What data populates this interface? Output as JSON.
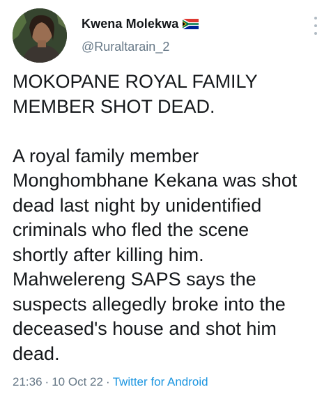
{
  "author": {
    "display_name": "Kwena Molekwa",
    "handle": "@Ruraltarain_2",
    "flag_icon": "south-africa-flag-icon",
    "avatar_icon": "profile-photo-avatar"
  },
  "menu": {
    "icon": "more-vertical-icon"
  },
  "tweet": {
    "text": "MOKOPANE ROYAL FAMILY\nMEMBER SHOT DEAD.\n\nA royal family member\nMonghombhane Kekana was shot\ndead last night by unidentified\ncriminals who fled the scene\nshortly after killing him.\nMahwelereng SAPS says the\nsuspects allegedly broke into the\ndeceased's house and shot him\ndead."
  },
  "meta": {
    "time": "21:36",
    "separator": "·",
    "date": "10 Oct 22",
    "source": "Twitter for Android"
  },
  "colors": {
    "text": "#14171a",
    "secondary": "#657786",
    "link": "#1b95e0",
    "background": "#ffffff"
  }
}
